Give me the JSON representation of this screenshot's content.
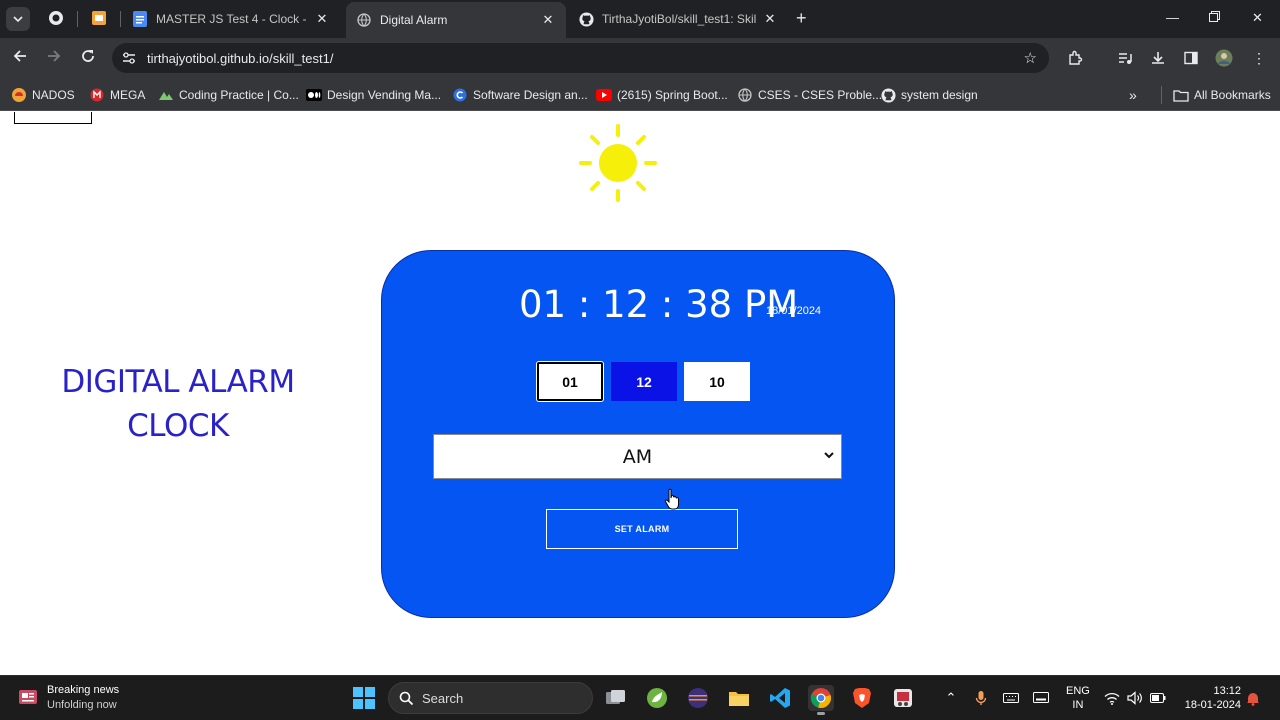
{
  "browser": {
    "tabs": [
      {
        "title": "MASTER JS Test 4 - Clock - Goo",
        "icon": "google-docs-icon",
        "active": false
      },
      {
        "title": "Digital Alarm",
        "icon": "globe-icon",
        "active": true
      },
      {
        "title": "TirthaJyotiBol/skill_test1: Skills t",
        "icon": "github-icon",
        "active": false
      }
    ],
    "url": "tirthajyotibol.github.io/skill_test1/",
    "bookmarks": [
      {
        "label": "NADOS",
        "icon": "nados-icon"
      },
      {
        "label": "MEGA",
        "icon": "mega-icon"
      },
      {
        "label": "Coding Practice | Co...",
        "icon": "coding-practice-icon"
      },
      {
        "label": "Design Vending Ma...",
        "icon": "medium-icon"
      },
      {
        "label": "Software Design an...",
        "icon": "software-design-icon"
      },
      {
        "label": "(2615) Spring Boot...",
        "icon": "youtube-icon"
      },
      {
        "label": "CSES - CSES Proble...",
        "icon": "globe-icon"
      },
      {
        "label": "system design",
        "icon": "github-icon"
      }
    ],
    "all_bookmarks_label": "All Bookmarks"
  },
  "page": {
    "side_title": [
      "DIGITAL ALARM",
      "CLOCK"
    ],
    "clock": {
      "time": "01 : 12 : 38 PM",
      "date": "18/01/2024"
    },
    "alarm_inputs": {
      "hour": "01",
      "minute": "12",
      "second": "10"
    },
    "ampm_selected": "AM",
    "set_alarm_label": "SET ALARM",
    "colors": {
      "panel": "#0455f2",
      "title": "#2a22c9",
      "sun": "#f5ef0a",
      "selected_input": "#0a12e6"
    }
  },
  "taskbar": {
    "news_title": "Breaking news",
    "news_subtitle": "Unfolding now",
    "search_label": "Search",
    "lang_line1": "ENG",
    "lang_line2": "IN",
    "time": "13:12",
    "date": "18-01-2024"
  }
}
